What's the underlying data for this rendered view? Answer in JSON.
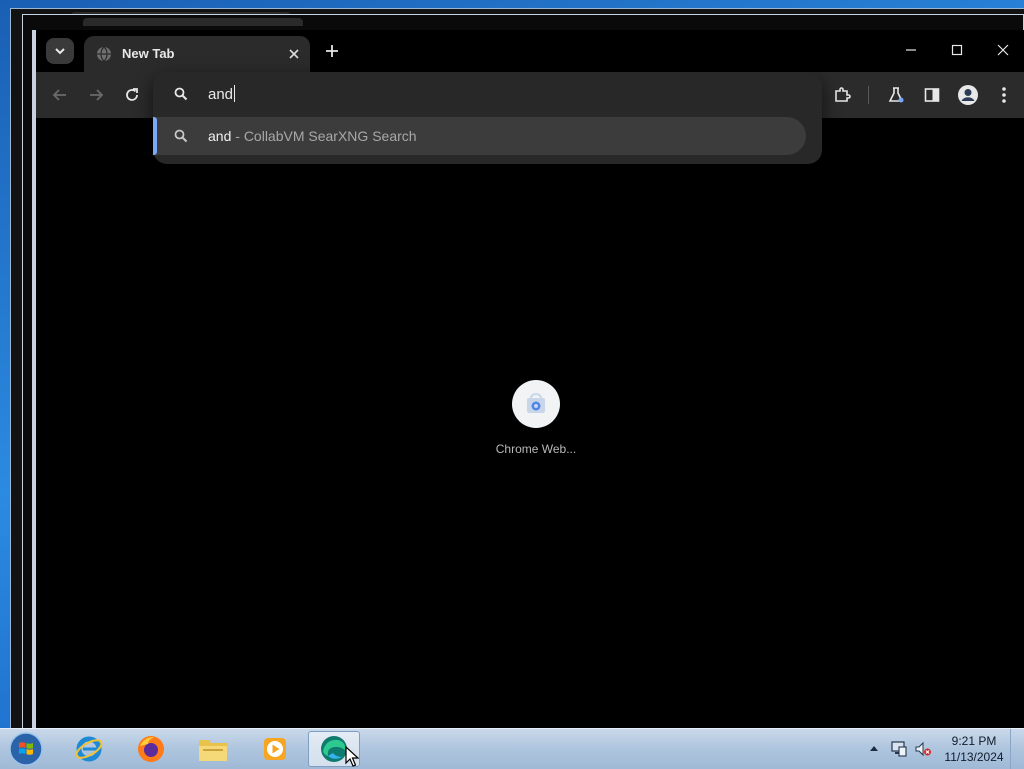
{
  "browser": {
    "tab": {
      "title": "New Tab"
    },
    "omnibox": {
      "query": "and",
      "suggestion": {
        "text": "and",
        "separator": " - ",
        "description": "CollabVM SearXNG Search"
      }
    },
    "shortcut": {
      "label": "Chrome Web..."
    }
  },
  "taskbar": {
    "clock": {
      "time": "9:21 PM",
      "date": "11/13/2024"
    }
  },
  "icons": {
    "tab_search": "chevron-down-icon",
    "favicon": "globe-icon",
    "close_tab": "close-icon",
    "new_tab": "plus-icon",
    "minimize": "minimize-icon",
    "maximize": "maximize-icon",
    "close_window": "close-icon",
    "back": "arrow-left-icon",
    "forward": "arrow-right-icon",
    "reload": "reload-icon",
    "search": "search-icon",
    "extensions": "puzzle-icon",
    "labs": "flask-icon",
    "side_panel": "side-panel-icon",
    "profile": "avatar-icon",
    "menu": "kebab-menu-icon"
  },
  "colors": {
    "accent": "#7aa7f7",
    "toolbar": "#2b2b2b",
    "omnibox": "#282828",
    "suggestion_highlight": "#3c3c3c"
  }
}
